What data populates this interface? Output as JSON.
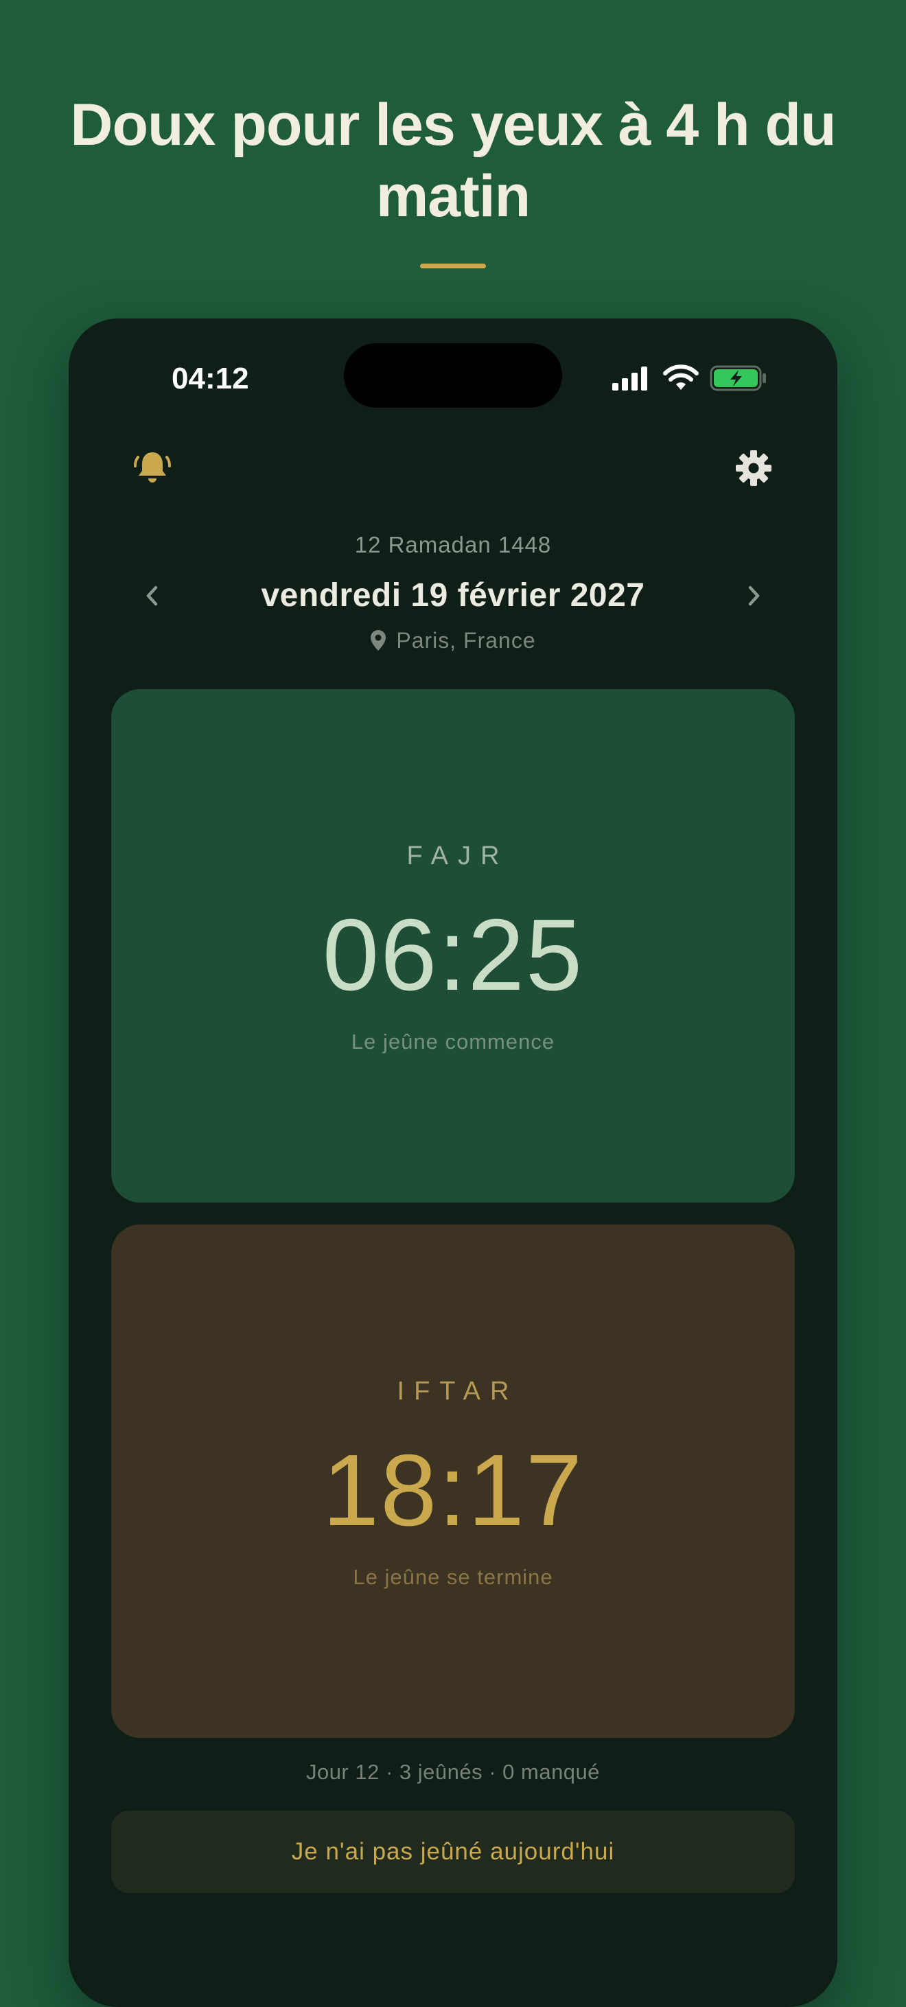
{
  "headline": "Doux pour les yeux à 4 h du matin",
  "status_bar": {
    "time": "04:12",
    "icons": [
      "cellular-signal-icon",
      "wifi-icon",
      "battery-charging-icon"
    ]
  },
  "header": {
    "left_icon": "bell-icon",
    "right_icon": "gear-icon",
    "hijri_date": "12 Ramadan 1448",
    "date": "vendredi 19 février 2027",
    "location": "Paris, France",
    "location_icon": "location-pin-icon",
    "prev_icon": "chevron-left-icon",
    "next_icon": "chevron-right-icon"
  },
  "fajr": {
    "label": "FAJR",
    "time": "06:25",
    "subtitle": "Le jeûne commence"
  },
  "iftar": {
    "label": "IFTAR",
    "time": "18:17",
    "subtitle": "Le jeûne se termine"
  },
  "stats": "Jour 12 · 3 jeûnés · 0 manqué",
  "action": {
    "label": "Je n'ai pas jeûné aujourd'hui"
  },
  "colors": {
    "background": "#1e5c3b",
    "phone": "#0f1f18",
    "gold_accent": "#c9a84e",
    "fajr_card": "#1e4e36",
    "iftar_card": "#3c3322"
  }
}
